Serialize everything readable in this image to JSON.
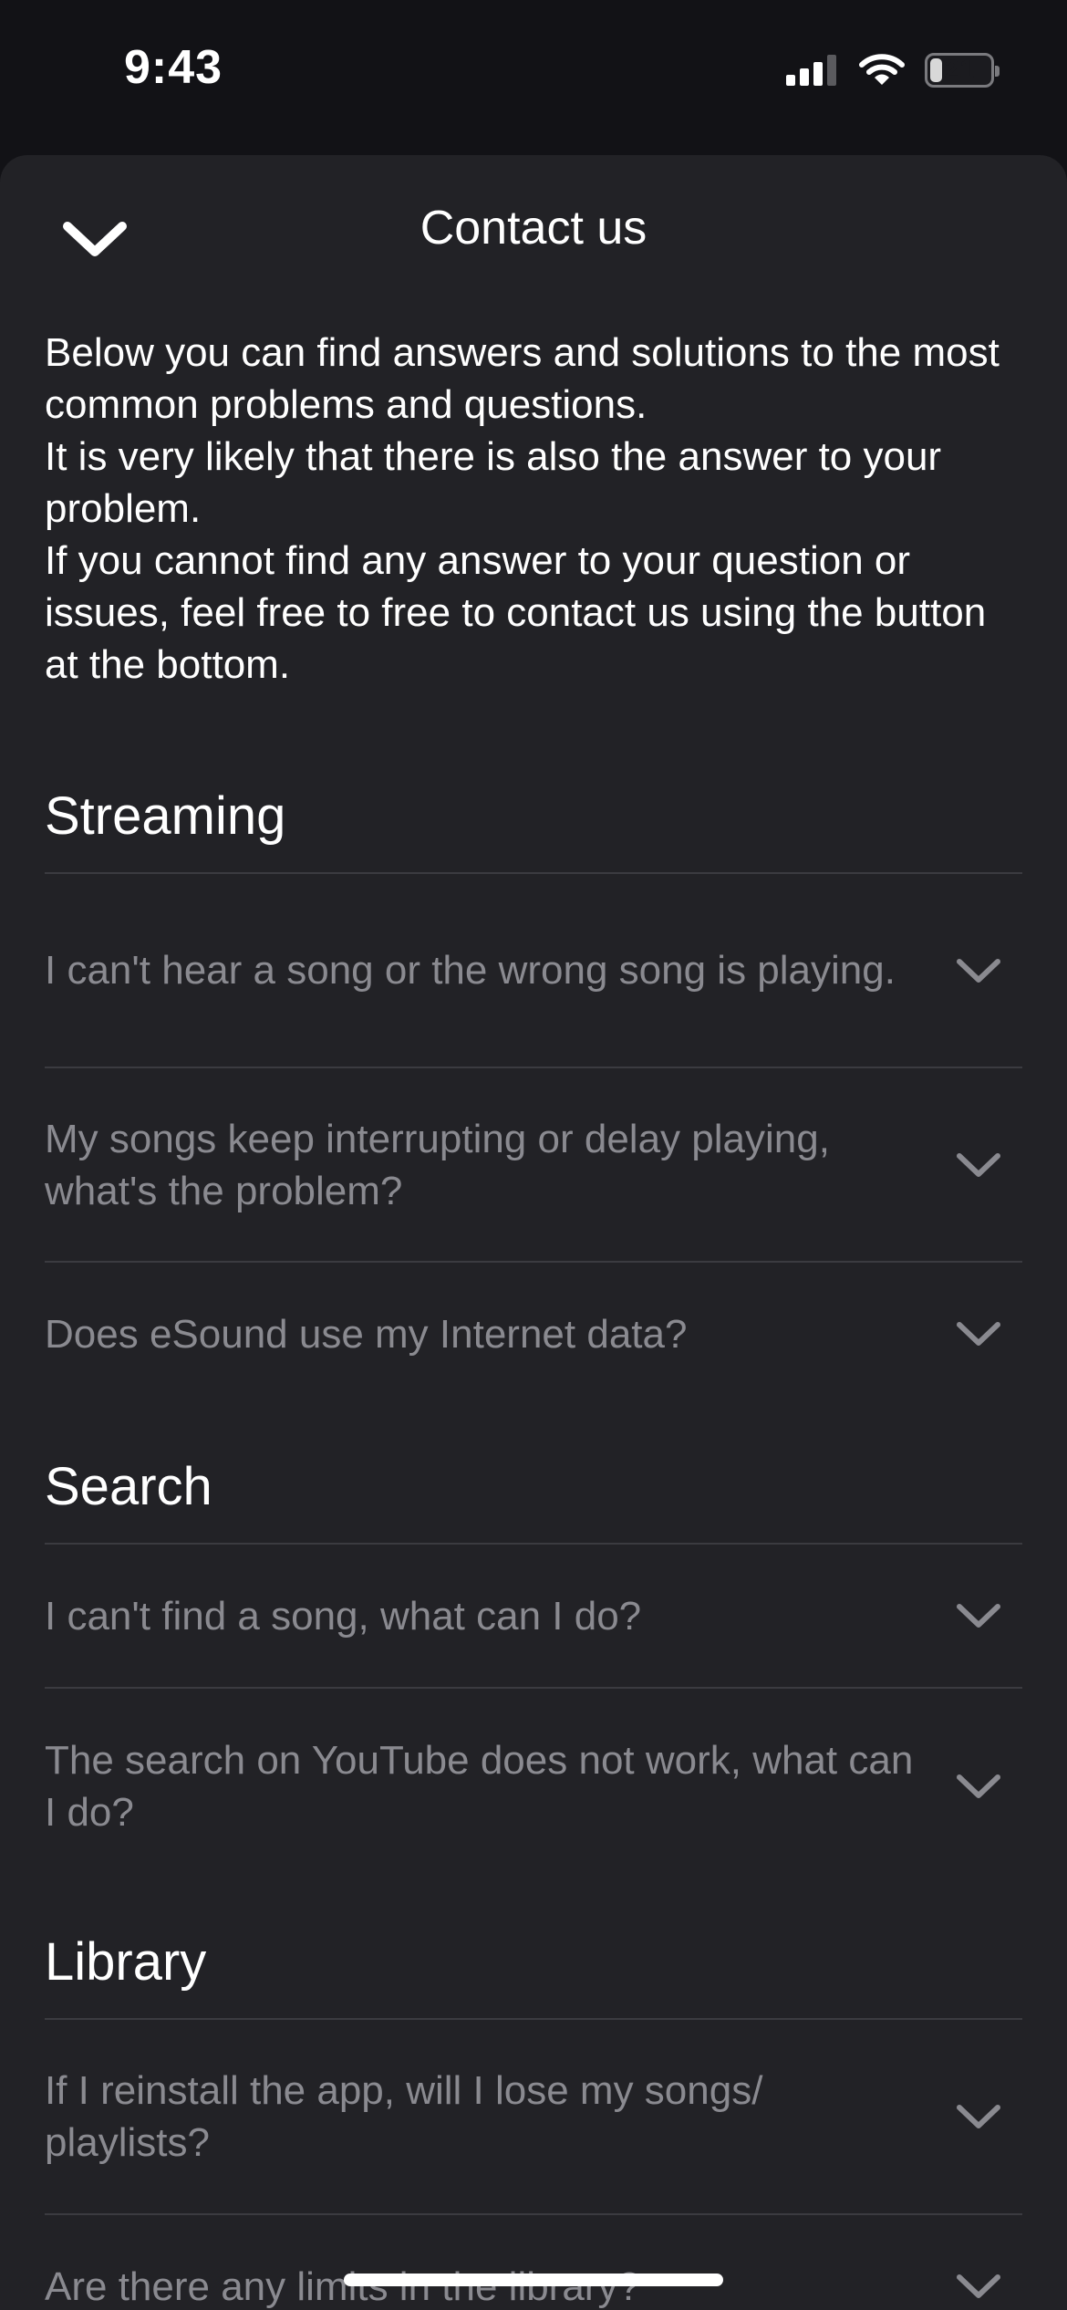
{
  "status_bar": {
    "time": "9:43",
    "battery_level": "21"
  },
  "header": {
    "title": "Contact us"
  },
  "intro": [
    "Below you can find answers and solutions to the most common problems and questions.",
    "It is very likely that there is also the answer to your problem.",
    "If you cannot find any answer to your question or issues, feel free to free to contact us using the button at the bottom."
  ],
  "sections": [
    {
      "title": "Streaming",
      "items": [
        "I can't hear a song or the wrong song is playing.",
        "My songs keep interrupting or delay playing, what's the problem?",
        "Does eSound use my Internet data?"
      ]
    },
    {
      "title": "Search",
      "items": [
        "I can't find a song, what can I do?",
        "The search on YouTube does not work, what can I do?"
      ]
    },
    {
      "title": "Library",
      "items": [
        "If I reinstall the app, will I lose my songs/ playlists?",
        "Are there any limits in the library?"
      ]
    }
  ],
  "colors": {
    "background": "#121216",
    "sheet": "#222226",
    "divider": "#3b3b40",
    "question_text": "#8a8a90"
  }
}
